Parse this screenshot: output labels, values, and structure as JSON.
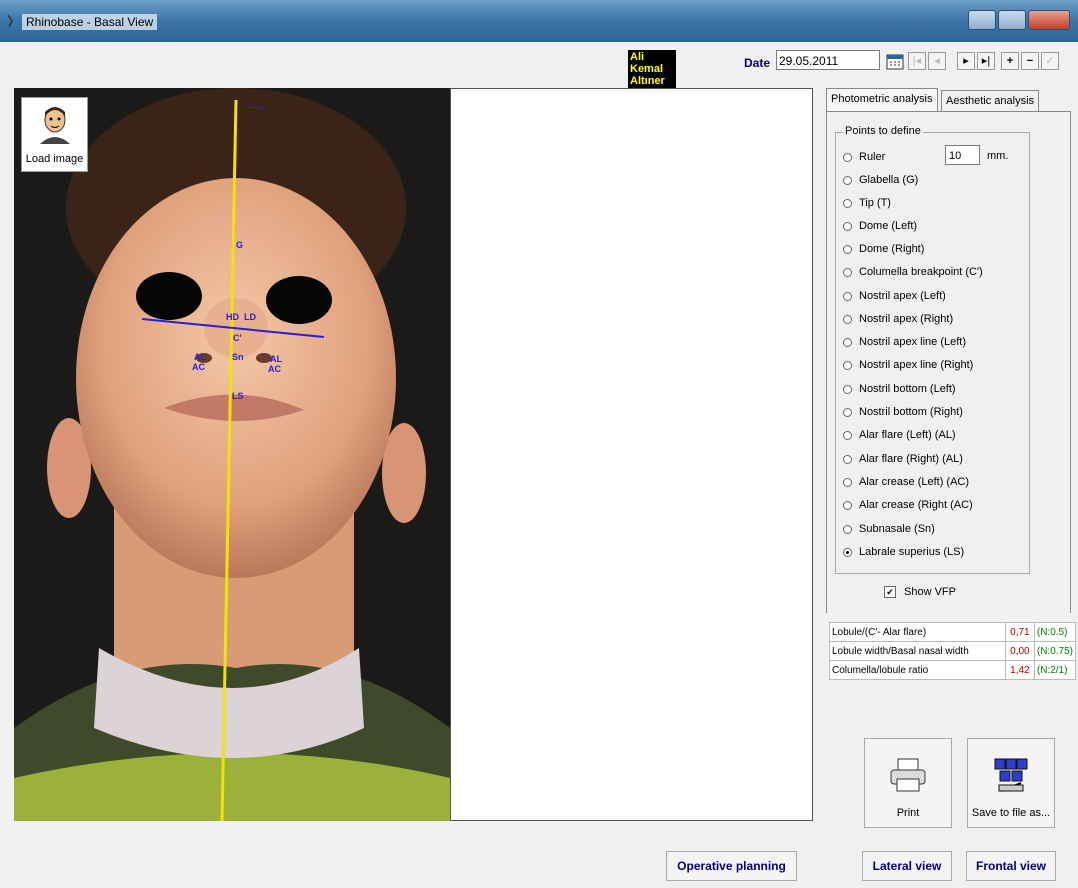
{
  "window": {
    "title": "Rhinobase - Basal View"
  },
  "header": {
    "patient_name": "Ali Kemal Altıner",
    "date_label": "Date",
    "date_value": "29.05.2011"
  },
  "image_panel": {
    "load_image_label": "Load image",
    "markers": [
      "G",
      "HD",
      "LD",
      "C'",
      "AL",
      "AC",
      "Sn",
      "AL",
      "AC",
      "LS"
    ]
  },
  "tabs": [
    {
      "label": "Photometric analysis",
      "active": true
    },
    {
      "label": "Aesthetic analysis",
      "active": false
    }
  ],
  "points_group": {
    "title": "Points to define",
    "ruler_value": "10",
    "ruler_unit": "mm.",
    "options": [
      {
        "label": "Ruler",
        "checked": false
      },
      {
        "label": "Glabella (G)",
        "checked": false
      },
      {
        "label": "Tip (T)",
        "checked": false
      },
      {
        "label": "Dome (Left)",
        "checked": false
      },
      {
        "label": "Dome (Right)",
        "checked": false
      },
      {
        "label": "Columella breakpoint (C')",
        "checked": false
      },
      {
        "label": "Nostril apex (Left)",
        "checked": false
      },
      {
        "label": "Nostril apex (Right)",
        "checked": false
      },
      {
        "label": "Nostril apex line (Left)",
        "checked": false
      },
      {
        "label": "Nostril apex line (Right)",
        "checked": false
      },
      {
        "label": "Nostril bottom (Left)",
        "checked": false
      },
      {
        "label": "Nostril bottom (Right)",
        "checked": false
      },
      {
        "label": "Alar flare (Left) (AL)",
        "checked": false
      },
      {
        "label": "Alar flare (Right) (AL)",
        "checked": false
      },
      {
        "label": "Alar crease (Left) (AC)",
        "checked": false
      },
      {
        "label": "Alar crease (Right (AC)",
        "checked": false
      },
      {
        "label": "Subnasale (Sn)",
        "checked": false
      },
      {
        "label": "Labrale superius (LS)",
        "checked": true
      }
    ]
  },
  "show_vfp": {
    "label": "Show VFP",
    "checked": true
  },
  "ratios": [
    {
      "name": "Lobule/(C'- Alar flare)",
      "value": "0,71",
      "norm": "(N:0.5)"
    },
    {
      "name": "Lobule width/Basal nasal width",
      "value": "0,00",
      "norm": "(N:0.75)"
    },
    {
      "name": "Columella/lobule ratio",
      "value": "1,42",
      "norm": "(N:2/1)"
    }
  ],
  "actions": {
    "print_label": "Print",
    "save_label": "Save to file as...",
    "operative_planning": "Operative planning",
    "lateral_view": "Lateral view",
    "frontal_view": "Frontal view"
  },
  "colors": {
    "vertical_line": "#f2e10a",
    "horizontal_line": "#2a1fd0",
    "markers": "#2a1fd0",
    "ratio_value": "#b00000",
    "ratio_norm": "#007f00",
    "link_text": "#00007f"
  }
}
